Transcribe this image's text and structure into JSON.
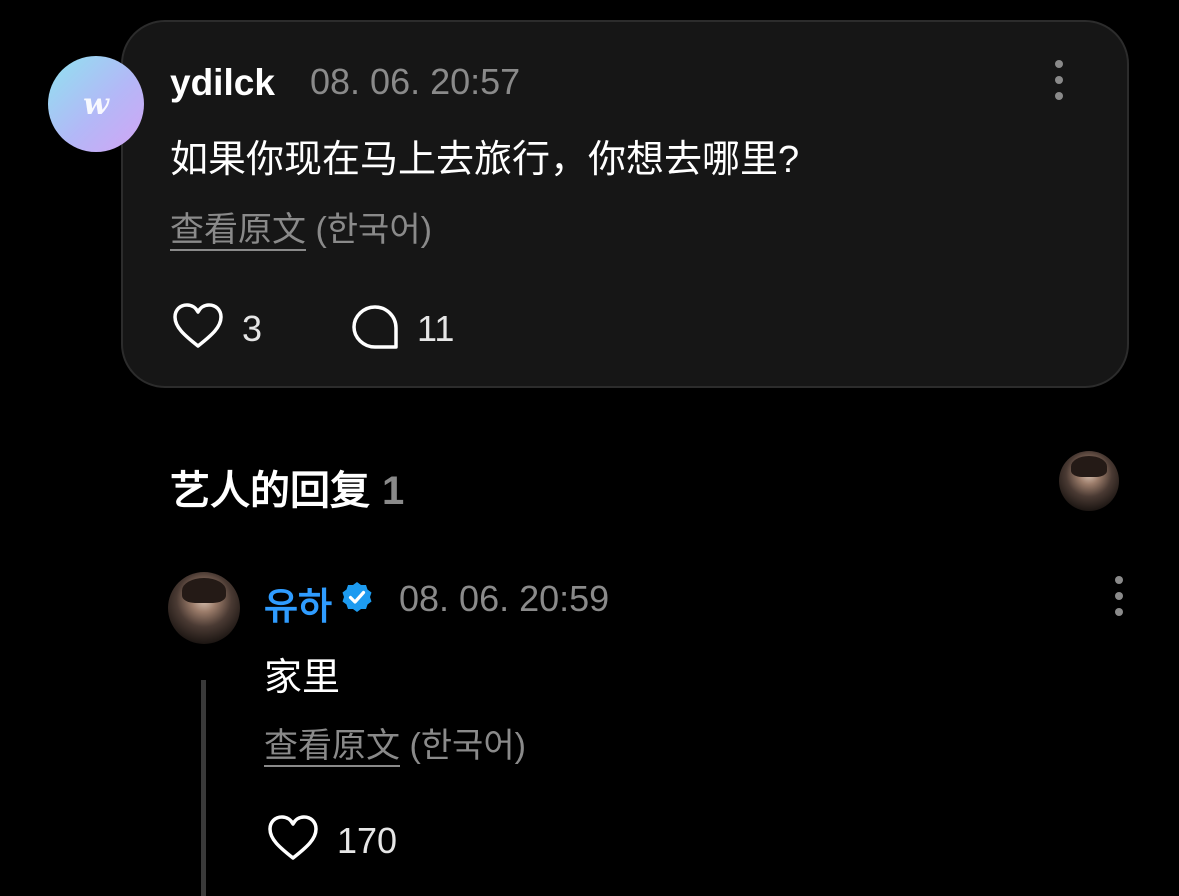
{
  "post": {
    "avatar_letter": "w",
    "username": "ydilck",
    "timestamp": "08. 06. 20:57",
    "text": "如果你现在马上去旅行，你想去哪里?",
    "translate_link": "查看原文",
    "translate_lang": "(한국어)",
    "likes": "3",
    "comments": "11"
  },
  "section": {
    "title": "艺人的回复",
    "count": "1"
  },
  "reply": {
    "name": "유하",
    "timestamp": "08. 06. 20:59",
    "text": "家里",
    "translate_link": "查看原文",
    "translate_lang": "(한국어)",
    "likes": "170"
  },
  "colors": {
    "background": "#000000",
    "card": "#161616",
    "muted": "#8a8a8a",
    "artist_name": "#2f9cff",
    "verified_badge": "#1d9bf0"
  },
  "icons": [
    "more-vertical-icon",
    "heart-icon",
    "comment-bubble-icon",
    "verified-badge-icon"
  ]
}
